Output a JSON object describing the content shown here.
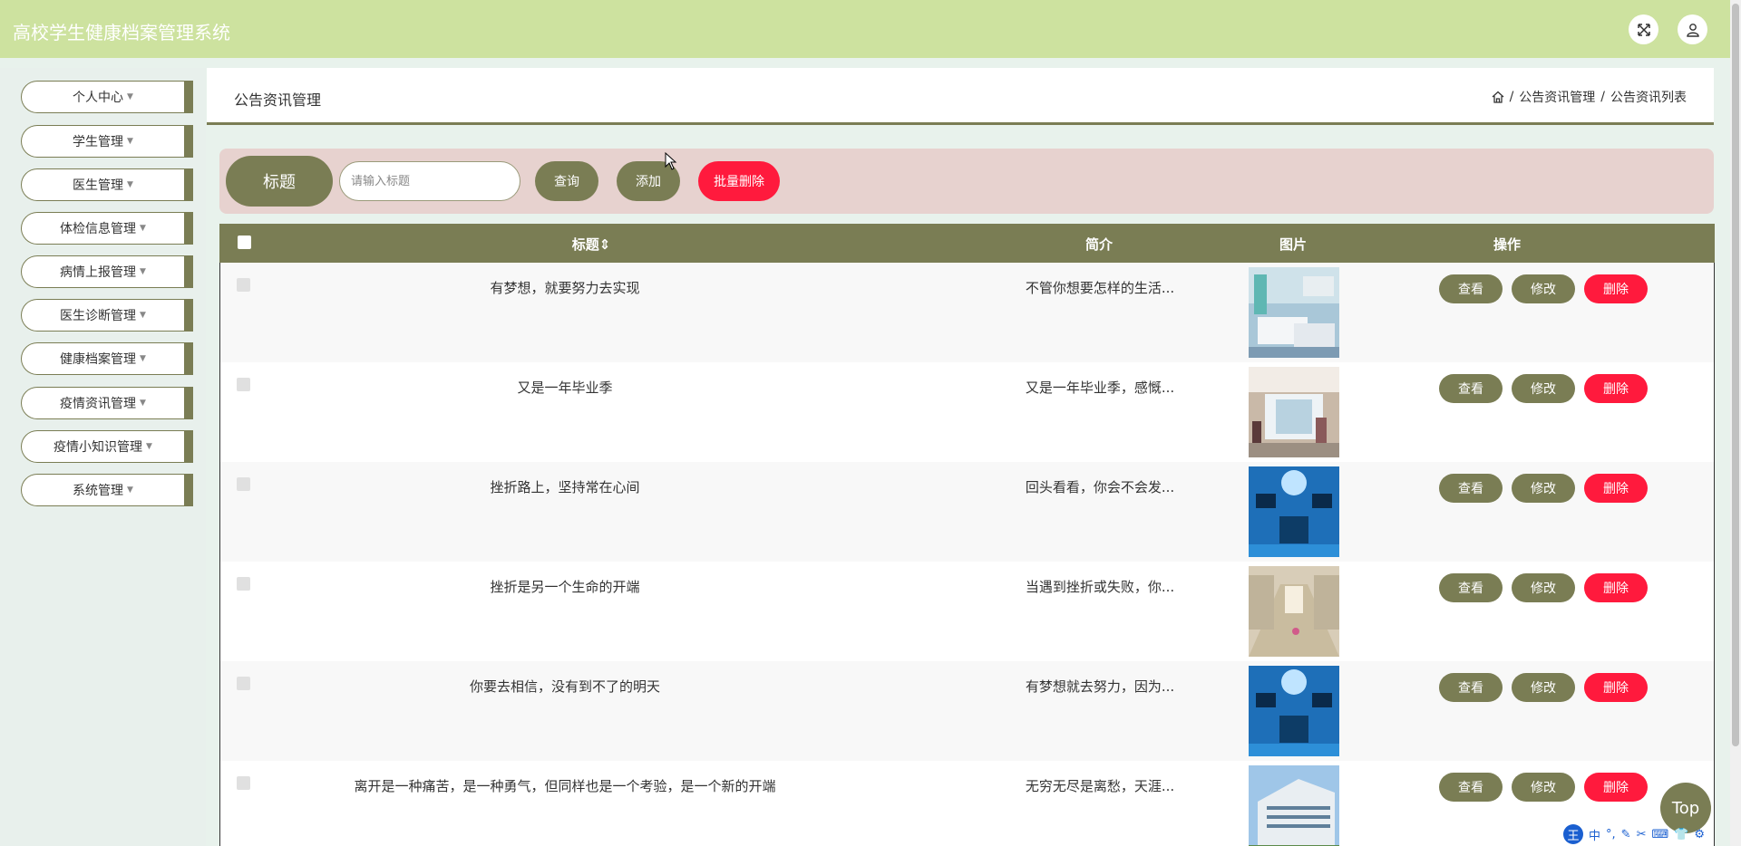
{
  "app": {
    "title": "高校学生健康档案管理系统"
  },
  "topbar": {
    "fullscreen_icon": "expand-icon",
    "user_icon": "user-icon"
  },
  "sidebar": {
    "items": [
      {
        "label": "个人中心"
      },
      {
        "label": "学生管理"
      },
      {
        "label": "医生管理"
      },
      {
        "label": "体检信息管理"
      },
      {
        "label": "病情上报管理"
      },
      {
        "label": "医生诊断管理"
      },
      {
        "label": "健康档案管理"
      },
      {
        "label": "疫情资讯管理"
      },
      {
        "label": "疫情小知识管理"
      },
      {
        "label": "系统管理"
      }
    ]
  },
  "header": {
    "title": "公告资讯管理",
    "breadcrumb": [
      "公告资讯管理",
      "公告资讯列表"
    ],
    "separator": "/"
  },
  "search": {
    "label": "标题",
    "placeholder": "请输入标题",
    "query_label": "查询",
    "add_label": "添加",
    "batch_delete_label": "批量删除"
  },
  "table": {
    "columns": {
      "title": "标题",
      "intro": "简介",
      "image": "图片",
      "actions": "操作"
    },
    "actions": {
      "view": "查看",
      "edit": "修改",
      "delete": "删除"
    },
    "rows": [
      {
        "title": "有梦想，就要努力去实现",
        "intro": "不管你想要怎样的生活...",
        "image": "hospital-ward"
      },
      {
        "title": "又是一年毕业季",
        "intro": "又是一年毕业季，感慨...",
        "image": "hospital-lobby"
      },
      {
        "title": "挫折路上，坚持常在心间",
        "intro": "回头看看，你会不会发...",
        "image": "operating-room"
      },
      {
        "title": "挫折是另一个生命的开端",
        "intro": "当遇到挫折或失败，你...",
        "image": "hospital-corridor"
      },
      {
        "title": "你要去相信，没有到不了的明天",
        "intro": "有梦想就去努力，因为...",
        "image": "operating-room"
      },
      {
        "title": "离开是一种痛苦，是一种勇气，但同样也是一个考验，是一个新的开端",
        "intro": "无穷无尽是离愁，天涯...",
        "image": "hospital-building"
      }
    ]
  },
  "back_to_top": {
    "label": "Top"
  },
  "ime_toolbar": {
    "logo": "王",
    "mode": "中"
  },
  "colors": {
    "topbar": "#cde29f",
    "accent": "#7a7d54",
    "danger": "#ff1a3d",
    "search_bg": "#e7d2cf"
  }
}
